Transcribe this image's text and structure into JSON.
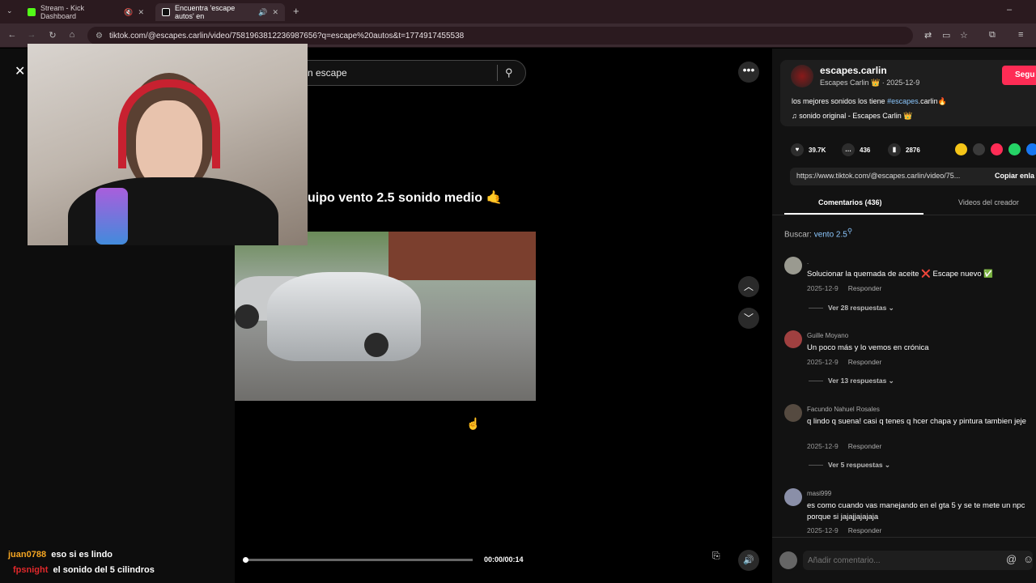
{
  "browser": {
    "tabs": [
      {
        "label": "Stream - Kick Dashboard",
        "color": "#53fc18"
      },
      {
        "label": "Encuentra 'escape autos' en",
        "color": "#ffffff"
      }
    ],
    "url": "tiktok.com/@escapes.carlin/video/7581963812236987656?q=escape%20autos&t=1774917455538"
  },
  "video": {
    "search_text": "n escape",
    "caption": "uipo vento 2.5 sonido medio 🤙",
    "time": "00:00/00:14",
    "progress": 0
  },
  "chat": [
    {
      "user": "juan0788",
      "user_color": "#f5a623",
      "message": "eso si es lindo"
    },
    {
      "user": "fpsnight",
      "user_color": "#e0282b",
      "message": "el sonido del 5 cilindros"
    }
  ],
  "author": {
    "name": "escapes.carlin",
    "display_name": "Escapes Carlin 👑",
    "date": "2025-12-9",
    "follow_label": "Segu",
    "description_before": "los mejores sonidos los tiene ",
    "description_hashtag": "#escapes",
    "description_after": ".carlin🔥",
    "sound": "♫  sonido original - Escapes Carlin 👑"
  },
  "stats": {
    "likes": "39.7K",
    "comments": "436",
    "saves": "2876"
  },
  "link": {
    "text": "https://www.tiktok.com/@escapes.carlin/video/75...",
    "copy_label": "Copiar enla"
  },
  "tabs": {
    "comments": "Comentarios (436)",
    "creator_videos": "Videos del creador"
  },
  "search": {
    "label": "Buscar: ",
    "query": "vento 2.5"
  },
  "comments": [
    {
      "user": ".",
      "text": "Solucionar la quemada de aceite ❌ Escape nuevo ✅",
      "date": "2025-12-9",
      "reply": "Responder",
      "replies": "Ver 28 respuestas ⌄"
    },
    {
      "user": "Guille Moyano",
      "text": "Un poco más y lo vemos en crónica",
      "date": "2025-12-9",
      "reply": "Responder",
      "replies": "Ver 13 respuestas ⌄"
    },
    {
      "user": "Facundo Nahuel Rosales",
      "text": "q lindo q suena! casi q tenes q hcer chapa y pintura tambien jeje",
      "date": "2025-12-9",
      "reply": "Responder",
      "replies": "Ver 5 respuestas ⌄"
    },
    {
      "user": "masi999",
      "text": "es como cuando vas manejando en el gta 5 y se te mete un npc porque si jajajjajajaja",
      "date": "2025-12-9",
      "reply": "Responder"
    }
  ],
  "comment_input": {
    "placeholder": "Añadir comentario..."
  }
}
